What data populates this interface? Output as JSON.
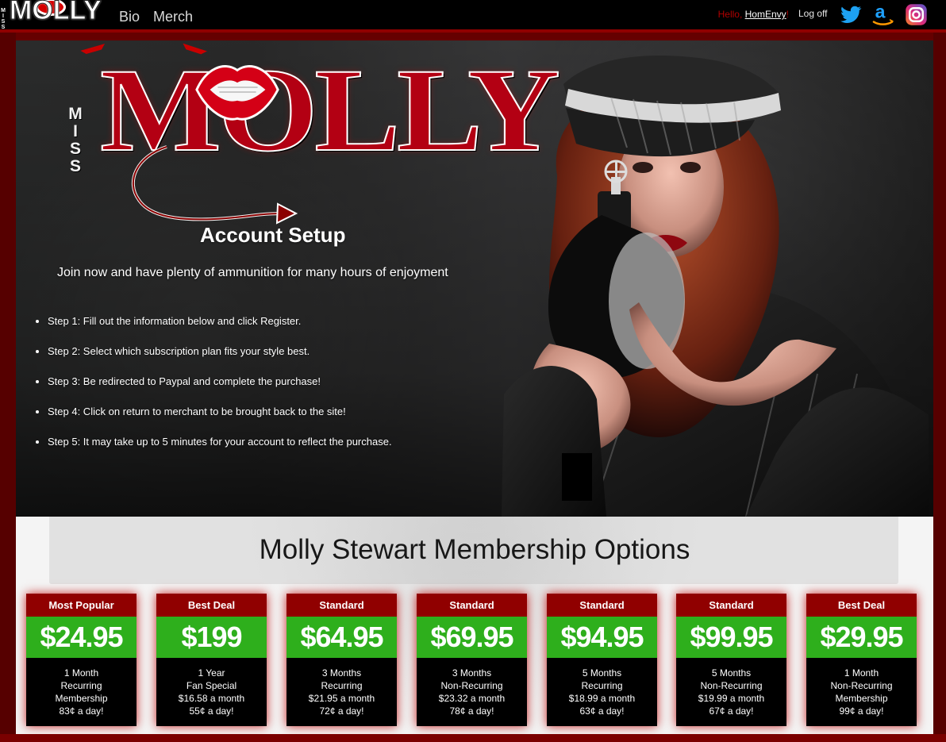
{
  "nav": {
    "brand": "MOLLY",
    "brand_side": "M I S S",
    "links": [
      "Bio",
      "Merch"
    ],
    "hello_prefix": "Hello, ",
    "hello_user": "HomEnvy",
    "hello_suffix": "!",
    "logoff": "Log off",
    "icons": [
      "twitter-icon",
      "amazon-icon",
      "instagram-icon"
    ]
  },
  "hero": {
    "logo_side": "M I S S",
    "logo_word": "MOLLY",
    "title": "Account Setup",
    "subtitle": "Join now and have plenty of ammunition for many hours of enjoyment",
    "steps": [
      "Step 1: Fill out the information below and click Register.",
      "Step 2: Select which subscription plan fits your style best.",
      "Step 3: Be redirected to Paypal and complete the purchase!",
      "Step 4: Click on return to merchant to be brought back to the site!",
      "Step 5: It may take up to 5 minutes for your account to reflect the purchase."
    ]
  },
  "membership": {
    "title": "Molly Stewart Membership Options",
    "plans": [
      {
        "label": "Most Popular",
        "price": "$24.95",
        "lines": [
          "1 Month",
          "Recurring",
          "Membership",
          "83¢ a day!"
        ]
      },
      {
        "label": "Best Deal",
        "price": "$199",
        "lines": [
          "1 Year",
          "Fan Special",
          "$16.58 a month",
          "55¢ a day!"
        ]
      },
      {
        "label": "Standard",
        "price": "$64.95",
        "lines": [
          "3 Months",
          "Recurring",
          "$21.95 a month",
          "72¢ a day!"
        ]
      },
      {
        "label": "Standard",
        "price": "$69.95",
        "lines": [
          "3 Months",
          "Non-Recurring",
          "$23.32 a month",
          "78¢ a day!"
        ]
      },
      {
        "label": "Standard",
        "price": "$94.95",
        "lines": [
          "5 Months",
          "Recurring",
          "$18.99 a month",
          "63¢ a day!"
        ]
      },
      {
        "label": "Standard",
        "price": "$99.95",
        "lines": [
          "5 Months",
          "Non-Recurring",
          "$19.99 a month",
          "67¢ a day!"
        ]
      },
      {
        "label": "Best Deal",
        "price": "$29.95",
        "lines": [
          "1 Month",
          "Non-Recurring",
          "Membership",
          "99¢ a day!"
        ]
      }
    ]
  },
  "colors": {
    "page_red": "#650000",
    "nav_black": "#000000",
    "card_header": "#900000",
    "price_green": "#2eaf1c"
  }
}
